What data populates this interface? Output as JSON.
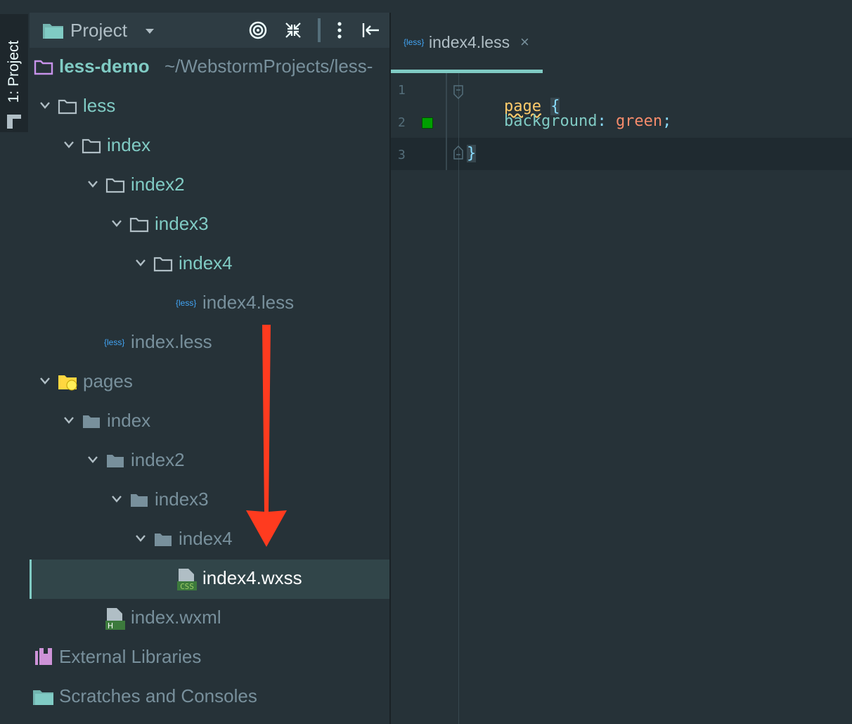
{
  "toolstrip": {
    "label": "1: Project"
  },
  "panel": {
    "title": "Project",
    "tree": [
      {
        "label": "less-demo",
        "path": "~/WebstormProjects/less-"
      },
      {
        "label": "less"
      },
      {
        "label": "index"
      },
      {
        "label": "index2"
      },
      {
        "label": "index3"
      },
      {
        "label": "index4"
      },
      {
        "label": "index4.less",
        "icon_badge": "{less}"
      },
      {
        "label": "index.less",
        "icon_badge": "{less}"
      },
      {
        "label": "pages"
      },
      {
        "label": "index"
      },
      {
        "label": "index2"
      },
      {
        "label": "index3"
      },
      {
        "label": "index4"
      },
      {
        "label": "index4.wxss",
        "icon_badge": "CSS"
      },
      {
        "label": "index.wxml",
        "icon_badge": "H"
      },
      {
        "label": "External Libraries"
      },
      {
        "label": "Scratches and Consoles"
      }
    ]
  },
  "editor": {
    "tab": {
      "title": "index4.less",
      "icon_badge": "{less}",
      "close": "×"
    },
    "lines": [
      {
        "no": "1",
        "selector": "page",
        "brace": "{"
      },
      {
        "no": "2",
        "property": "background",
        "colon": ":",
        "value": "green",
        "semi": ";"
      },
      {
        "no": "3",
        "brace": "}"
      }
    ]
  },
  "colors": {
    "background": "#263238",
    "accent": "#80cbc4",
    "folder_text": "#80cbc4",
    "muted_text": "#78909c",
    "arrow": "#ff3b1f"
  }
}
